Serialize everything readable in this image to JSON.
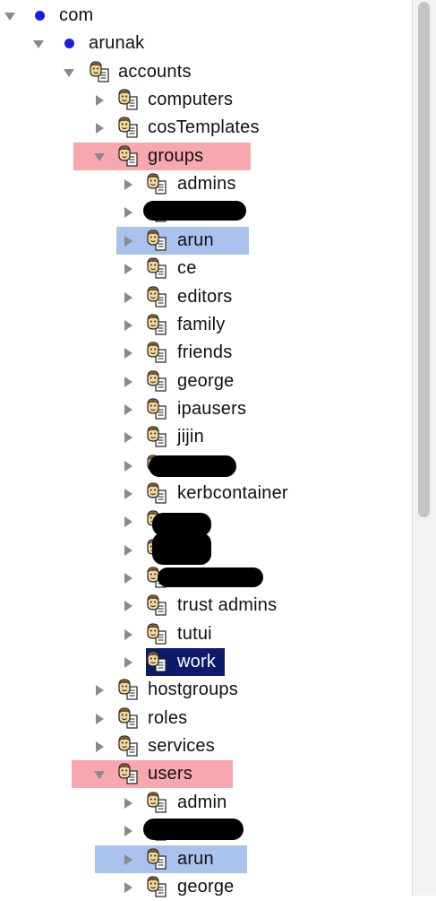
{
  "icons": {
    "expanded": "triangle-down-icon",
    "collapsed": "triangle-right-icon",
    "domain": "blue-dot-icon",
    "node": "ldap-entry-face-icon"
  },
  "colors": {
    "red_highlight": "#f7a7ad",
    "blue_highlight": "#a9c2ee",
    "selection": "#0e1a6b",
    "dot": "#1c1ce6",
    "redaction": "#000000"
  },
  "tree": [
    {
      "label": "com",
      "level": 0,
      "state": "expanded",
      "icon": "domain"
    },
    {
      "label": "arunak",
      "level": 1,
      "state": "expanded",
      "icon": "domain"
    },
    {
      "label": "accounts",
      "level": 2,
      "state": "expanded",
      "icon": "node"
    },
    {
      "label": "computers",
      "level": 3,
      "state": "collapsed",
      "icon": "node"
    },
    {
      "label": "cosTemplates",
      "level": 3,
      "state": "collapsed",
      "icon": "node"
    },
    {
      "label": "groups",
      "level": 3,
      "state": "expanded",
      "icon": "node",
      "highlight": "red"
    },
    {
      "label": "admins",
      "level": 4,
      "state": "collapsed",
      "icon": "node"
    },
    {
      "label": "",
      "level": 4,
      "state": "collapsed",
      "icon": "node",
      "redacted": true
    },
    {
      "label": "arun",
      "level": 4,
      "state": "collapsed",
      "icon": "node",
      "highlight": "blue"
    },
    {
      "label": "ce",
      "level": 4,
      "state": "collapsed",
      "icon": "node"
    },
    {
      "label": "editors",
      "level": 4,
      "state": "collapsed",
      "icon": "node"
    },
    {
      "label": "family",
      "level": 4,
      "state": "collapsed",
      "icon": "node"
    },
    {
      "label": "friends",
      "level": 4,
      "state": "collapsed",
      "icon": "node"
    },
    {
      "label": "george",
      "level": 4,
      "state": "collapsed",
      "icon": "node"
    },
    {
      "label": "ipausers",
      "level": 4,
      "state": "collapsed",
      "icon": "node"
    },
    {
      "label": "jijin",
      "level": 4,
      "state": "collapsed",
      "icon": "node"
    },
    {
      "label": "",
      "level": 4,
      "state": "collapsed",
      "icon": "node",
      "redacted": true
    },
    {
      "label": "kerbcontainer",
      "level": 4,
      "state": "collapsed",
      "icon": "node"
    },
    {
      "label": "",
      "level": 4,
      "state": "collapsed",
      "icon": "node",
      "redacted": true
    },
    {
      "label": "",
      "level": 4,
      "state": "collapsed",
      "icon": "node",
      "redacted": true
    },
    {
      "label": "",
      "level": 4,
      "state": "collapsed",
      "icon": "node",
      "redacted": true
    },
    {
      "label": "trust admins",
      "level": 4,
      "state": "collapsed",
      "icon": "node"
    },
    {
      "label": "tutui",
      "level": 4,
      "state": "collapsed",
      "icon": "node"
    },
    {
      "label": "work",
      "level": 4,
      "state": "collapsed",
      "icon": "node",
      "highlight": "selected"
    },
    {
      "label": "hostgroups",
      "level": 3,
      "state": "collapsed",
      "icon": "node"
    },
    {
      "label": "roles",
      "level": 3,
      "state": "collapsed",
      "icon": "node"
    },
    {
      "label": "services",
      "level": 3,
      "state": "collapsed",
      "icon": "node"
    },
    {
      "label": "users",
      "level": 3,
      "state": "expanded",
      "icon": "node",
      "highlight": "red"
    },
    {
      "label": "admin",
      "level": 4,
      "state": "collapsed",
      "icon": "node"
    },
    {
      "label": "",
      "level": 4,
      "state": "collapsed",
      "icon": "node",
      "redacted": true
    },
    {
      "label": "arun",
      "level": 4,
      "state": "collapsed",
      "icon": "node",
      "highlight": "blue"
    },
    {
      "label": "george",
      "level": 4,
      "state": "collapsed",
      "icon": "node"
    }
  ]
}
